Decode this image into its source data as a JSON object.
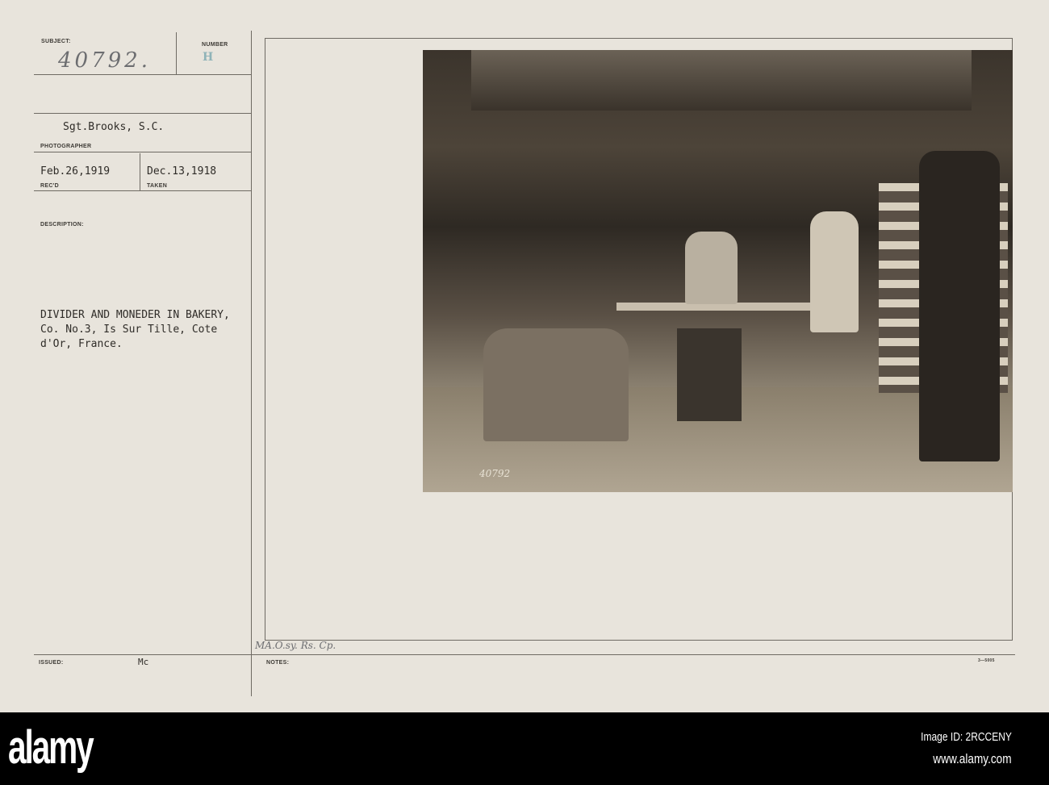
{
  "card": {
    "subject_label": "SUBJECT:",
    "subject_value": "40792.",
    "number_label": "NUMBER",
    "number_value": "H",
    "photographer_value": "Sgt.Brooks, S.C.",
    "photographer_label": "PHOTOGRAPHER",
    "recd_value": "Feb.26,1919",
    "recd_label": "REC'D",
    "taken_value": "Dec.13,1918",
    "taken_label": "TAKEN",
    "description_label": "DESCRIPTION:",
    "description_lines": [
      "DIVIDER AND MONEDER IN BAKERY,",
      "Co. No.3, Is Sur Tille, Cote",
      "d'Or, France."
    ],
    "issued_label": "ISSUED:",
    "issued_value": "Mc",
    "notes_label": "NOTES:",
    "notes_handwritten": "MA.O.sy. Rs. Cp.",
    "form_number": "3—5005",
    "photo_number": "40792"
  },
  "footer": {
    "logo": "alamy",
    "image_id": "Image ID: 2RCCENY",
    "url": "www.alamy.com"
  }
}
